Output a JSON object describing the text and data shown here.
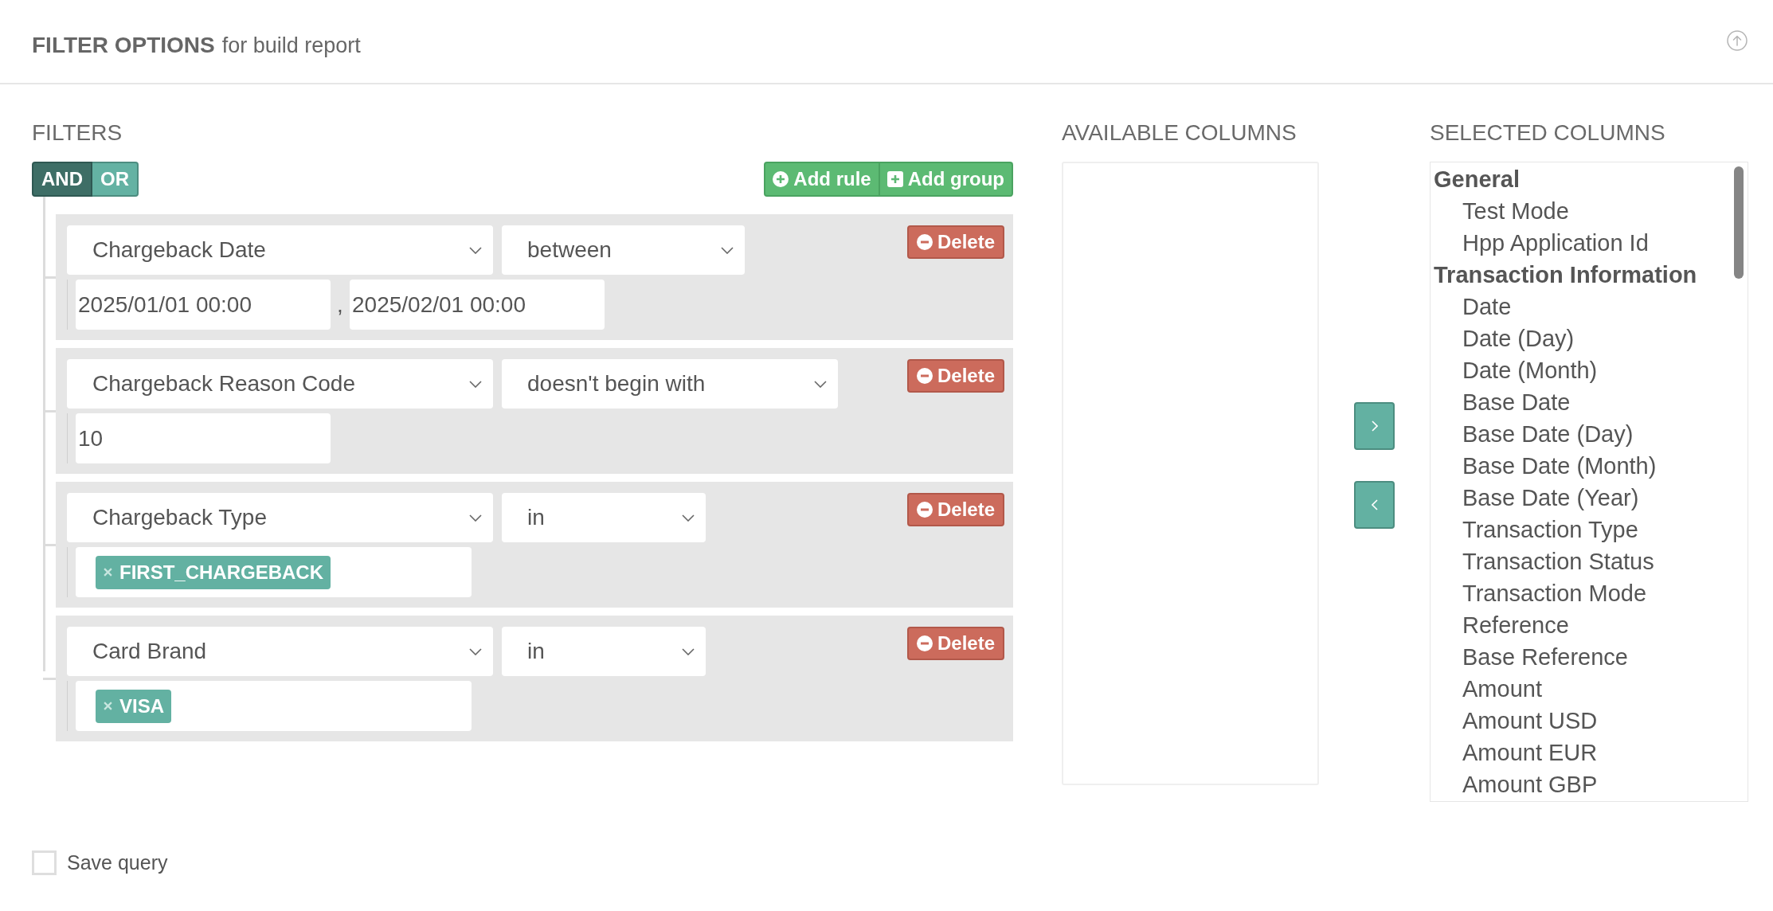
{
  "header": {
    "title": "FILTER OPTIONS",
    "subtitle": "for build report"
  },
  "filters": {
    "heading": "FILTERS",
    "conditions": [
      {
        "label": "AND",
        "selected": true
      },
      {
        "label": "OR",
        "selected": false
      }
    ],
    "actions": [
      {
        "kind": "add-rule",
        "label": "Add rule"
      },
      {
        "kind": "add-group",
        "label": "Add group"
      }
    ],
    "rules": [
      {
        "field": "Chargeback Date",
        "operator": "between",
        "delete_label": "Delete",
        "value": {
          "kind": "range",
          "inputs": [
            "2025/01/01 00:00",
            "2025/02/01 00:00"
          ],
          "separator": ","
        }
      },
      {
        "field": "Chargeback Reason Code",
        "operator": "doesn't begin with",
        "delete_label": "Delete",
        "value": {
          "kind": "text",
          "inputs": [
            "10"
          ]
        }
      },
      {
        "field": "Chargeback Type",
        "operator": "in",
        "delete_label": "Delete",
        "value": {
          "kind": "tags",
          "tags": [
            "FIRST_CHARGEBACK"
          ]
        }
      },
      {
        "field": "Card Brand",
        "operator": "in",
        "delete_label": "Delete",
        "value": {
          "kind": "tags",
          "tags": [
            "VISA"
          ]
        }
      }
    ]
  },
  "available_columns": {
    "heading": "AVAILABLE COLUMNS"
  },
  "selected_columns": {
    "heading": "SELECTED COLUMNS",
    "groups": [
      {
        "label": "General",
        "children": [
          {
            "label": "Test Mode",
            "selected": false
          },
          {
            "label": "Hpp Application Id",
            "selected": false
          }
        ]
      },
      {
        "label": "Transaction Information",
        "children": [
          {
            "label": "Date",
            "selected": false
          },
          {
            "label": "Date (Day)",
            "selected": false
          },
          {
            "label": "Date (Month)",
            "selected": false
          },
          {
            "label": "Base Date",
            "selected": false
          },
          {
            "label": "Base Date (Day)",
            "selected": false
          },
          {
            "label": "Base Date (Month)",
            "selected": false
          },
          {
            "label": "Base Date (Year)",
            "selected": false
          },
          {
            "label": "Transaction Type",
            "selected": false
          },
          {
            "label": "Transaction Status",
            "selected": false
          },
          {
            "label": "Transaction Mode",
            "selected": false
          },
          {
            "label": "Reference",
            "selected": false
          },
          {
            "label": "Base Reference",
            "selected": false
          },
          {
            "label": "Amount",
            "selected": false
          },
          {
            "label": "Amount USD",
            "selected": false
          },
          {
            "label": "Amount EUR",
            "selected": false
          },
          {
            "label": "Amount GBP",
            "selected": false
          }
        ]
      }
    ]
  },
  "save_query": {
    "label": "Save query",
    "checked": false
  }
}
